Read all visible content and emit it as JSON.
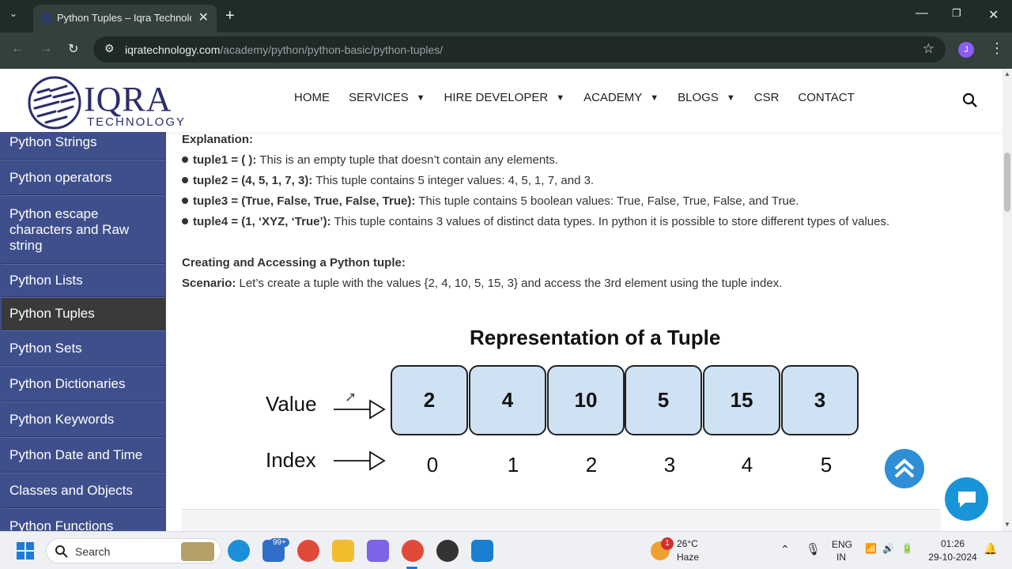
{
  "browser": {
    "tab_title": "Python Tuples – Iqra Technolog",
    "url_host": "iqratechnology.com",
    "url_path": "/academy/python/python-basic/python-tuples/",
    "profile_initial": "J"
  },
  "site": {
    "logo_word": "IQRA",
    "logo_sub": "TECHNOLOGY",
    "nav": [
      "HOME",
      "SERVICES",
      "HIRE DEVELOPER",
      "ACADEMY",
      "BLOGS",
      "CSR",
      "CONTACT"
    ]
  },
  "sidebar": {
    "items": [
      "Python Strings",
      "Python operators",
      "Python escape characters and Raw string",
      "Python Lists",
      "Python Tuples",
      "Python Sets",
      "Python Dictionaries",
      "Python Keywords",
      "Python Date and Time",
      "Classes and Objects",
      "Python Functions"
    ],
    "active": "Python Tuples"
  },
  "content": {
    "explanation_heading": "Explanation:",
    "bullets": [
      {
        "code": "tuple1 = ( ):",
        "text": " This is an empty tuple that doesn’t contain any elements."
      },
      {
        "code": "tuple2 = (4, 5, 1, 7, 3):",
        "text": " This tuple contains 5 integer values: 4, 5, 1, 7, and 3."
      },
      {
        "code": "tuple3 = (True, False, True, False, True):",
        "text": " This tuple contains 5 boolean values: True, False, True, False, and True."
      },
      {
        "code": "tuple4 = (1, ‘XYZ, ‘True’):",
        "text": " This tuple contains 3 values of distinct data types. In python it is possible to store different types of values."
      }
    ],
    "section_heading": "Creating and Accessing a Python tuple:",
    "scenario_label": "Scenario:",
    "scenario_text": " Let’s create a tuple with the values {2, 4, 10, 5, 15, 3} and access the 3rd element using the tuple index."
  },
  "diagram": {
    "title": "Representation of a Tuple",
    "value_label": "Value",
    "index_label": "Index",
    "values": [
      "2",
      "4",
      "10",
      "5",
      "15",
      "3"
    ],
    "indices": [
      "0",
      "1",
      "2",
      "3",
      "4",
      "5"
    ],
    "cell_color": "#cfe2f3"
  },
  "taskbar": {
    "search_placeholder": "Search",
    "mail_badge": "99+",
    "weather_temp": "26°C",
    "weather_desc": "Haze",
    "weather_badge": "1",
    "lang_1": "ENG",
    "lang_2": "IN",
    "time": "01:26",
    "date": "29-10-2024"
  },
  "icons": [
    "dropdown-icon",
    "close-icon",
    "new-tab-icon",
    "back-icon",
    "forward-icon",
    "reload-icon",
    "site-info-icon",
    "bookmark-star-icon",
    "menu-icon",
    "search-icon",
    "scroll-top-icon",
    "chat-icon",
    "windows-start-icon"
  ]
}
